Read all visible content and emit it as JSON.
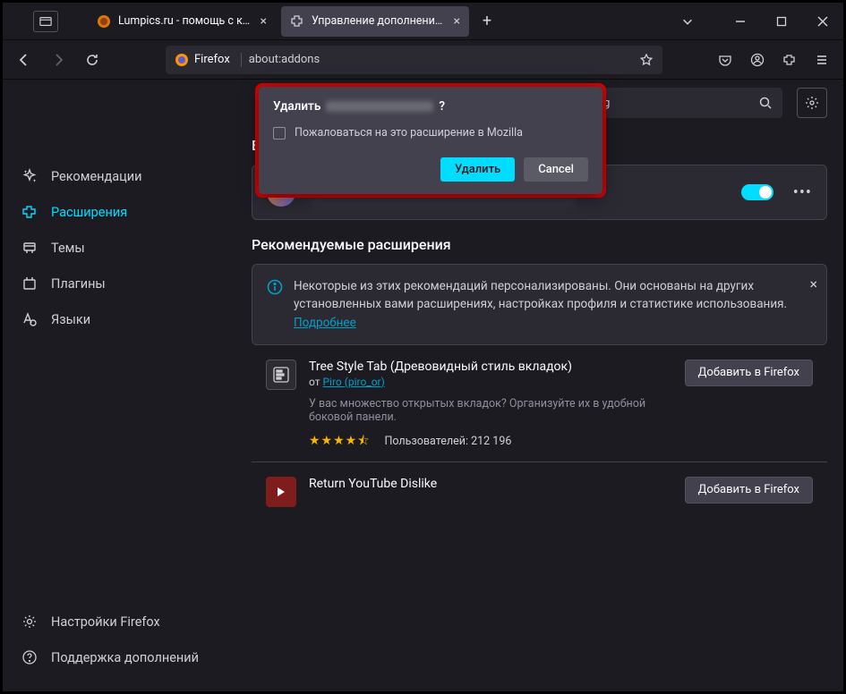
{
  "tabs": {
    "t1": "Lumpics.ru - помощь с компь",
    "t2": "Управление дополнениями"
  },
  "urlbar": {
    "app": "Firefox",
    "addr": "about:addons"
  },
  "sidebar": {
    "rec": "Рекомендации",
    "ext": "Расширения",
    "themes": "Темы",
    "plugins": "Плагины",
    "lang": "Языки",
    "settings": "Настройки Firefox",
    "support": "Поддержка дополнений"
  },
  "search": {
    "placeholder": "на addons.mozilla.org"
  },
  "sections": {
    "enabled": "Включены",
    "recommended": "Рекомендуемые расширения"
  },
  "banner": {
    "text": "Некоторые из этих рекомендаций персонализированы. Они основаны на других установленных вами расширениях, настройках профиля и статистике использования.",
    "link": "Подробнее"
  },
  "rec1": {
    "title": "Tree Style Tab (Древовидный стиль вкладок)",
    "by": "от",
    "author": "Piro (piro_or)",
    "desc": "У вас множество открытых вкладок? Организуйте их в удобной боковой панели.",
    "users_label": "Пользователей:",
    "users": "212 196",
    "add": "Добавить в Firefox"
  },
  "rec2": {
    "title": "Return YouTube Dislike",
    "add": "Добавить в Firefox"
  },
  "dialog": {
    "title": "Удалить",
    "checkbox": "Пожаловаться на это расширение в Mozilla",
    "primary": "Удалить",
    "secondary": "Cancel"
  }
}
